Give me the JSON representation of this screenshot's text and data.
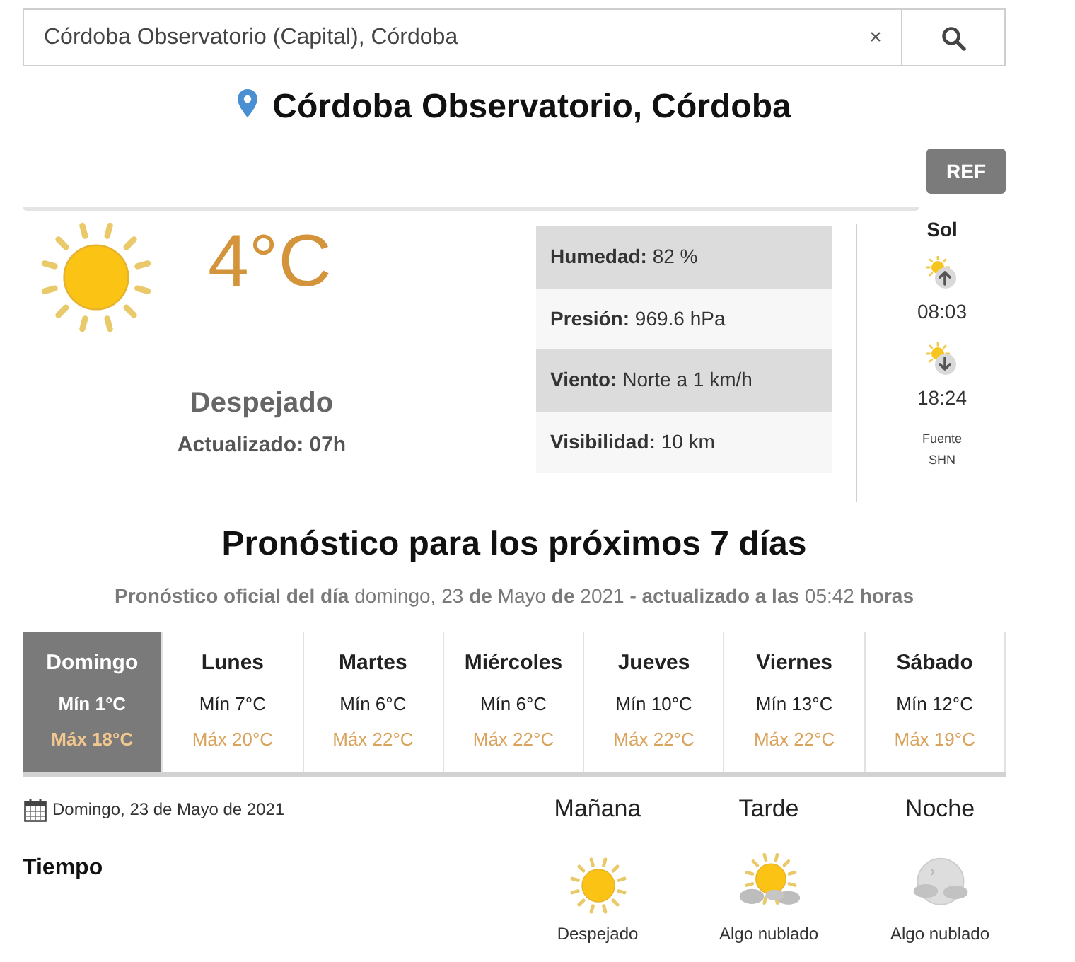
{
  "search": {
    "value": "Córdoba Observatorio (Capital), Córdoba",
    "clear": "×"
  },
  "location": {
    "title": "Córdoba Observatorio, Córdoba"
  },
  "ref_button": "REF",
  "current": {
    "temperature": "4°C",
    "condition": "Despejado",
    "updated": "Actualizado: 07h",
    "details": [
      {
        "label": "Humedad:",
        "value": "82 %"
      },
      {
        "label": "Presión:",
        "value": "969.6 hPa"
      },
      {
        "label": "Viento:",
        "value": "Norte a 1 km/h"
      },
      {
        "label": "Visibilidad:",
        "value": "10 km"
      }
    ]
  },
  "sun": {
    "title": "Sol",
    "times": [
      {
        "kind": "sunrise",
        "time": "08:03"
      },
      {
        "kind": "sunset",
        "time": "18:24"
      }
    ],
    "source_label": "Fuente",
    "source": "SHN"
  },
  "forecast": {
    "title": "Pronóstico para los próximos 7 días",
    "subtitle": "**Pronóstico oficial del día** domingo, 23 **de** Mayo **de** 2021 **- actualizado a las** 05:42 **horas**",
    "days": [
      {
        "name": "Domingo",
        "min": "Mín 1°C",
        "max": "Máx 18°C",
        "selected": true
      },
      {
        "name": "Lunes",
        "min": "Mín 7°C",
        "max": "Máx 20°C",
        "selected": false
      },
      {
        "name": "Martes",
        "min": "Mín 6°C",
        "max": "Máx 22°C",
        "selected": false
      },
      {
        "name": "Miércoles",
        "min": "Mín 6°C",
        "max": "Máx 22°C",
        "selected": false
      },
      {
        "name": "Jueves",
        "min": "Mín 10°C",
        "max": "Máx 22°C",
        "selected": false
      },
      {
        "name": "Viernes",
        "min": "Mín 13°C",
        "max": "Máx 22°C",
        "selected": false
      },
      {
        "name": "Sábado",
        "min": "Mín 12°C",
        "max": "Máx 19°C",
        "selected": false
      }
    ]
  },
  "day_detail": {
    "date": "Domingo, 23 de Mayo de 2021",
    "row_label": "Tiempo",
    "periods": [
      {
        "name": "Mañana",
        "kind": "clear",
        "condition": "Despejado"
      },
      {
        "name": "Tarde",
        "kind": "partly_cloudy",
        "condition": "Algo nublado"
      },
      {
        "name": "Noche",
        "kind": "cloudy_night",
        "condition": "Algo nublado"
      }
    ]
  }
}
